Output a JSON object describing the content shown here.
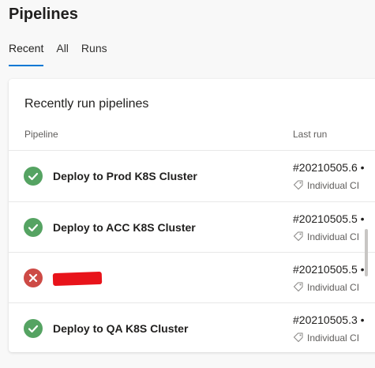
{
  "page": {
    "title": "Pipelines"
  },
  "tabs": [
    {
      "label": "Recent",
      "selected": true
    },
    {
      "label": "All",
      "selected": false
    },
    {
      "label": "Runs",
      "selected": false
    }
  ],
  "card": {
    "title": "Recently run pipelines",
    "columns": {
      "pipeline": "Pipeline",
      "last_run": "Last run"
    }
  },
  "rows": [
    {
      "status": "succeeded",
      "status_icon": "check-icon",
      "name": "Deploy to Prod K8S Cluster",
      "run": "#20210505.6 •",
      "trigger": "Individual CI"
    },
    {
      "status": "succeeded",
      "status_icon": "check-icon",
      "name": "Deploy to ACC K8S Cluster",
      "run": "#20210505.5 •",
      "trigger": "Individual CI"
    },
    {
      "status": "failed",
      "status_icon": "x-icon",
      "name": "",
      "name_redacted": true,
      "run": "#20210505.5 •",
      "trigger": "Individual CI"
    },
    {
      "status": "succeeded",
      "status_icon": "check-icon",
      "name": "Deploy to QA K8S Cluster",
      "run": "#20210505.3 •",
      "trigger": "Individual CI"
    }
  ],
  "colors": {
    "accent": "#0078d4",
    "succeeded": "#55a362",
    "failed": "#cd4a45",
    "redaction": "#e8131a"
  }
}
